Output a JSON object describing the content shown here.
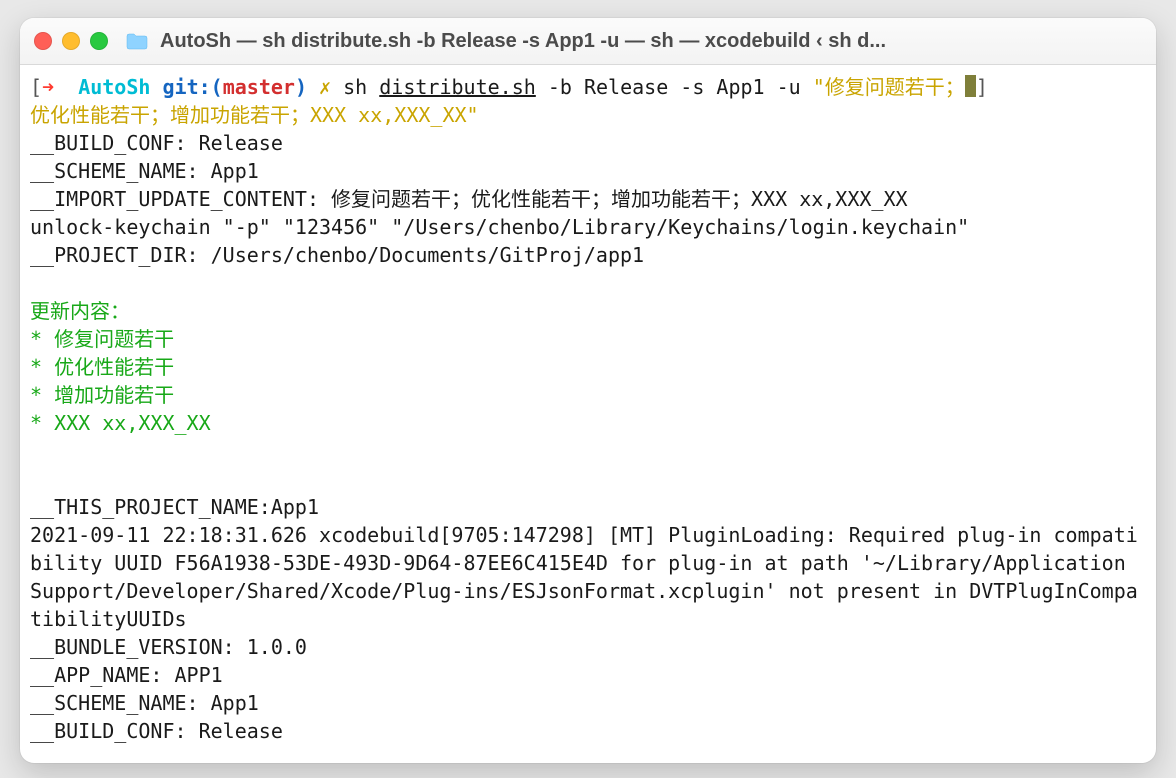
{
  "window": {
    "title": "AutoSh — sh distribute.sh -b Release -s App1 -u  — sh — xcodebuild ‹ sh d..."
  },
  "prompt": {
    "arrow": "➜",
    "dir": "AutoSh",
    "gitlabel": "git:(",
    "branch": "master",
    "gitclose": ")",
    "dirty": "✗",
    "cmd_prefix": "sh ",
    "cmd_file": "distribute.sh",
    "cmd_args": " -b Release -s App1 -u ",
    "cmd_quote_open": "\"",
    "cmd_str1": "修复问题若干；",
    "cmd_str2": "优化性能若干；增加功能若干；XXX xx,XXX_XX\""
  },
  "output": {
    "line_build_conf": "__BUILD_CONF: Release",
    "line_scheme": "__SCHEME_NAME: App1",
    "line_import": "__IMPORT_UPDATE_CONTENT: 修复问题若干；优化性能若干；增加功能若干；XXX xx,XXX_XX",
    "line_unlock": "unlock-keychain \"-p\" \"123456\" \"/Users/chenbo/Library/Keychains/login.keychain\"",
    "line_projdir": "__PROJECT_DIR: /Users/chenbo/Documents/GitProj/app1",
    "update_header": "更新内容：",
    "update_items": [
      "* 修复问题若干",
      "* 优化性能若干",
      "* 增加功能若干",
      "* XXX xx,XXX_XX"
    ],
    "line_projname": "__THIS_PROJECT_NAME:App1",
    "line_xcodebuild": "2021-09-11 22:18:31.626 xcodebuild[9705:147298] [MT] PluginLoading: Required plug-in compatibility UUID F56A1938-53DE-493D-9D64-87EE6C415E4D for plug-in at path '~/Library/Application Support/Developer/Shared/Xcode/Plug-ins/ESJsonFormat.xcplugin' not present in DVTPlugInCompatibilityUUIDs",
    "line_bundle": "__BUNDLE_VERSION: 1.0.0",
    "line_appname": "__APP_NAME: APP1",
    "line_scheme2": "__SCHEME_NAME: App1",
    "line_build_conf2": "__BUILD_CONF: Release"
  }
}
